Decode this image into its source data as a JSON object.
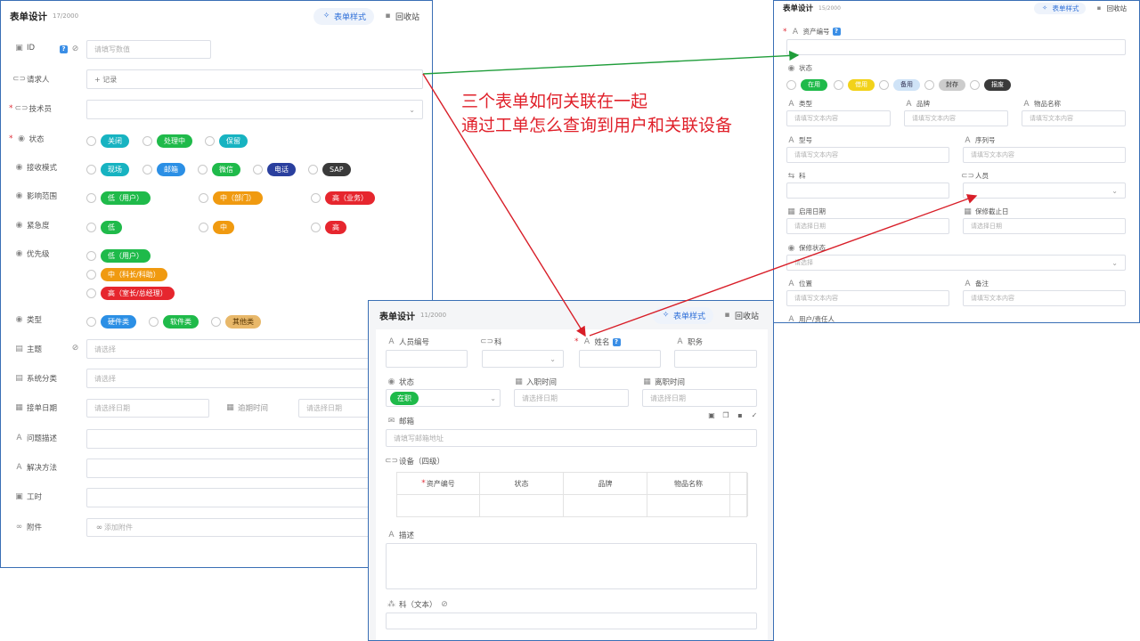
{
  "colors": {
    "accent": "#2e6fd8",
    "teal": "#17b3c1",
    "green": "#1fba4a",
    "blue": "#2b8fe5",
    "navy": "#2a3f9e",
    "dark": "#3a3a3a",
    "orange": "#f09a10",
    "red": "#e6262e",
    "yellow": "#f2d21a",
    "gray": "#cccccc",
    "tan": "#e8b86a"
  },
  "common": {
    "style_button": "表单样式",
    "bin_button": "回收站",
    "ph_text": "请填写文本内容",
    "ph_date": "请选择日期",
    "ph_select": "请选择"
  },
  "form1": {
    "title": "表单设计",
    "count": "17/2000",
    "fields": {
      "id": "ID",
      "requester": "请求人",
      "technician": "技术员",
      "status": "状态",
      "receive_mode": "接收模式",
      "impact": "影响范围",
      "urgency": "紧急度",
      "priority": "优先级",
      "type": "类型",
      "subject": "主题",
      "system_class": "系统分类",
      "order_date": "接单日期",
      "overdue": "逾期时间",
      "problem": "问题描述",
      "solution": "解决方法",
      "hours": "工时",
      "attachment": "附件"
    },
    "placeholders": {
      "id": "请填写数值",
      "record": "+ 记录",
      "select": "请选择",
      "date": "请选择日期",
      "attach": "添加附件"
    },
    "status_opts": [
      "关闭",
      "处理中",
      "保留"
    ],
    "receive_opts": [
      "现场",
      "邮箱",
      "微信",
      "电话",
      "SAP"
    ],
    "impact_opts": [
      "低（用户）",
      "中（部门）",
      "高（业务）"
    ],
    "urgency_opts": [
      "低",
      "中",
      "高"
    ],
    "priority_opts": [
      "低（用户）",
      "中（科长/科助）",
      "高（室长/总经理）"
    ],
    "type_opts": [
      "硬件类",
      "软件类",
      "其他类"
    ]
  },
  "form2": {
    "title": "表单设计",
    "count": "15/2000",
    "fields": {
      "asset_no": "资产编号",
      "status": "状态",
      "type": "类型",
      "brand": "品牌",
      "item_name": "物品名称",
      "model": "型号",
      "serial": "序列号",
      "dept": "科",
      "person": "人员",
      "start_date": "启用日期",
      "warranty_end": "保修截止日",
      "warranty_status": "保修状态",
      "location": "位置",
      "remark": "备注",
      "owner": "用户/责任人"
    },
    "status_opts": [
      "在用",
      "借用",
      "备用",
      "封存",
      "报废"
    ]
  },
  "form3": {
    "title": "表单设计",
    "count": "11/2000",
    "fields": {
      "emp_no": "人员编号",
      "dept": "科",
      "name": "姓名",
      "position": "职务",
      "status": "状态",
      "join_date": "入职时间",
      "leave_date": "离职时间",
      "email": "邮箱",
      "devices": "设备（四级）",
      "desc": "描述",
      "dept_text": "科（文本）"
    },
    "status_value": "在职",
    "email_placeholder": "请填写邮箱地址",
    "table_headers": [
      "资产编号",
      "状态",
      "品牌",
      "物品名称"
    ]
  },
  "annotation": {
    "line1": "三个表单如何关联在一起",
    "line2": "通过工单怎么查询到用户和关联设备"
  }
}
